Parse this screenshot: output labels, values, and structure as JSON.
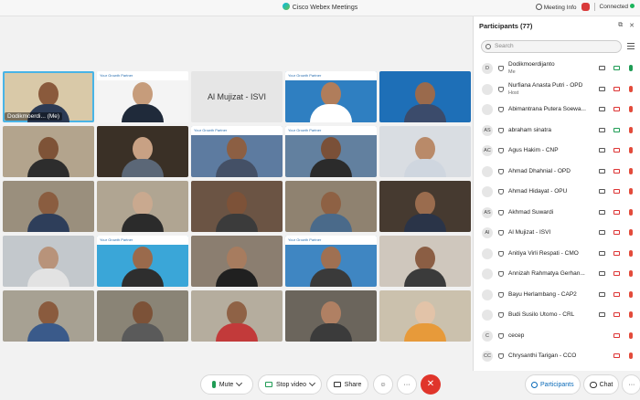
{
  "window": {
    "title": "Cisco Webex Meetings",
    "meeting_info": "Meeting Info",
    "status": "Connected"
  },
  "tiles": [
    {
      "label": "Dodikmoerdi... (Me)",
      "bg": "#d9c9a8",
      "skin": "#8a5a3c",
      "shirt": "#2c3b55",
      "active": true,
      "banner": false
    },
    {
      "label": "",
      "bg": "#f4f4f4",
      "skin": "#c69c7b",
      "shirt": "#1f2a3a",
      "banner": true
    },
    {
      "label": "",
      "bg": "#e6e6e6",
      "center_name": "Al Mujizat - ISVI"
    },
    {
      "label": "",
      "bg": "#2f7fc1",
      "skin": "#b07d5b",
      "shirt": "#ffffff",
      "banner": true
    },
    {
      "label": "",
      "bg": "#1e6fb7",
      "skin": "#9a6a4c",
      "shirt": "#3b4b6b",
      "banner": false
    },
    {
      "label": "",
      "bg": "#b3a48d",
      "skin": "#7e5337",
      "shirt": "#2d2d2d"
    },
    {
      "label": "",
      "bg": "#3a3026",
      "skin": "#c8a184",
      "shirt": "#5b6777"
    },
    {
      "label": "",
      "bg": "#5d7ba0",
      "skin": "#8c5f43",
      "shirt": "#445066",
      "banner": true
    },
    {
      "label": "",
      "bg": "#62809f",
      "skin": "#7a5038",
      "shirt": "#2b2b2b",
      "banner": true
    },
    {
      "label": "",
      "bg": "#d9dde2",
      "skin": "#b98a69",
      "shirt": "#cfd6df"
    },
    {
      "label": "",
      "bg": "#9a8f7d",
      "skin": "#8a5d40",
      "shirt": "#2e3e5a"
    },
    {
      "label": "",
      "bg": "#b0a592",
      "skin": "#c9a98f",
      "shirt": "#2b2b2b"
    },
    {
      "label": "",
      "bg": "#6b5444",
      "skin": "#7d5238",
      "shirt": "#3b3b3b"
    },
    {
      "label": "",
      "bg": "#8f8270",
      "skin": "#8e6144",
      "shirt": "#4a6a8a"
    },
    {
      "label": "",
      "bg": "#463a30",
      "skin": "#9a6c4e",
      "shirt": "#2a3448"
    },
    {
      "label": "",
      "bg": "#c3c8cc",
      "skin": "#b8937a",
      "shirt": "#e2e2e2"
    },
    {
      "label": "",
      "bg": "#3aa6d8",
      "skin": "#9a6a4c",
      "shirt": "#2e2e2e",
      "banner": true
    },
    {
      "label": "",
      "bg": "#8b7e70",
      "skin": "#a77c5f",
      "shirt": "#202020"
    },
    {
      "label": "",
      "bg": "#3f86c2",
      "skin": "#9f7052",
      "shirt": "#3a3a3a",
      "banner": true
    },
    {
      "label": "",
      "bg": "#cfc7bd",
      "skin": "#8b5e44",
      "shirt": "#3b3b3b"
    },
    {
      "label": "",
      "bg": "#a7a193",
      "skin": "#8a5b3e",
      "shirt": "#3a5a8a"
    },
    {
      "label": "",
      "bg": "#8a8476",
      "skin": "#7c5238",
      "shirt": "#5a5a5a"
    },
    {
      "label": "",
      "bg": "#b5ad9e",
      "skin": "#8f6246",
      "shirt": "#c23a3a"
    },
    {
      "label": "",
      "bg": "#6b655c",
      "skin": "#b08063",
      "shirt": "#3b3b3b"
    },
    {
      "label": "",
      "bg": "#cbc1ad",
      "skin": "#e2c3a8",
      "shirt": "#e79a3a"
    }
  ],
  "tile_banner_text": "Your Growth Partner",
  "participants": {
    "title": "Participants (77)",
    "search_placeholder": "Search",
    "items": [
      {
        "initials": "D",
        "name": "Dodikmoerdijanto",
        "sub": "Me",
        "cam": true,
        "mic": true
      },
      {
        "initials": "",
        "name": "Nurfiana Anasta Putri - OPD",
        "sub": "Host",
        "cam": false,
        "mic": false
      },
      {
        "initials": "",
        "name": "Abimantrana Putera Soewa...",
        "sub": "",
        "cam": false,
        "mic": false
      },
      {
        "initials": "AS",
        "name": "abraham sinatra",
        "sub": "",
        "cam": true,
        "mic": false
      },
      {
        "initials": "AC",
        "name": "Agus Hakim - CNP",
        "sub": "",
        "cam": false,
        "mic": false
      },
      {
        "initials": "",
        "name": "Ahmad Dhahnial - OPD",
        "sub": "",
        "cam": false,
        "mic": false
      },
      {
        "initials": "",
        "name": "Ahmad Hidayat - OPU",
        "sub": "",
        "cam": false,
        "mic": false
      },
      {
        "initials": "AS",
        "name": "Akhmad Suwardi",
        "sub": "",
        "cam": false,
        "mic": false
      },
      {
        "initials": "AI",
        "name": "Al Mujizat - ISVI",
        "sub": "",
        "cam": false,
        "mic": false
      },
      {
        "initials": "",
        "name": "Anitiya Virli Respati - CMO",
        "sub": "",
        "cam": false,
        "mic": false
      },
      {
        "initials": "",
        "name": "Annizah Rahmatya Gerhan...",
        "sub": "",
        "cam": false,
        "mic": false
      },
      {
        "initials": "",
        "name": "Bayu Herlambang - CAP2",
        "sub": "",
        "cam": false,
        "mic": false
      },
      {
        "initials": "",
        "name": "Budi Susilo Utomo - CRL",
        "sub": "",
        "cam": false,
        "mic": false
      },
      {
        "initials": "C",
        "name": "cecep",
        "sub": "",
        "cam": false,
        "mic": false
      },
      {
        "initials": "CC",
        "name": "Chrysanthi Tarigan - CCO",
        "sub": "",
        "cam": false,
        "mic": false
      }
    ]
  },
  "controls": {
    "mute": "Mute",
    "stop_video": "Stop video",
    "share": "Share",
    "participants_tab": "Participants",
    "chat_tab": "Chat",
    "more": "···",
    "end": "✕"
  }
}
